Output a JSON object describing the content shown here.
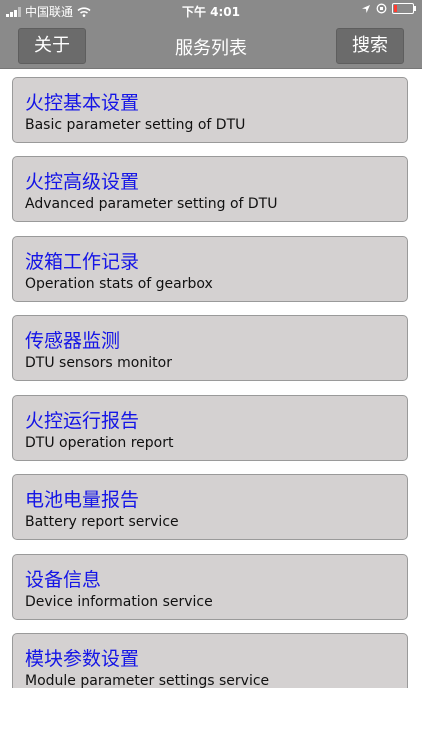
{
  "status_bar": {
    "carrier": "中国联通",
    "time": "下午 4:01"
  },
  "navbar": {
    "left_button": "关于",
    "title": "服务列表",
    "right_button": "搜索"
  },
  "items": [
    {
      "title": "火控基本设置",
      "subtitle": "Basic parameter setting of DTU"
    },
    {
      "title": "火控高级设置",
      "subtitle": "Advanced parameter setting of DTU"
    },
    {
      "title": "波箱工作记录",
      "subtitle": "Operation stats of gearbox"
    },
    {
      "title": "传感器监测",
      "subtitle": "DTU sensors monitor"
    },
    {
      "title": "火控运行报告",
      "subtitle": "DTU operation report"
    },
    {
      "title": "电池电量报告",
      "subtitle": "Battery report service"
    },
    {
      "title": "设备信息",
      "subtitle": "Device information service"
    },
    {
      "title": "模块参数设置",
      "subtitle": "Module parameter settings service"
    }
  ],
  "colors": {
    "bar": "#8a8a8a",
    "button": "#6b6b6b",
    "item_bg": "#d4d1d1",
    "item_title": "#1515e6"
  }
}
